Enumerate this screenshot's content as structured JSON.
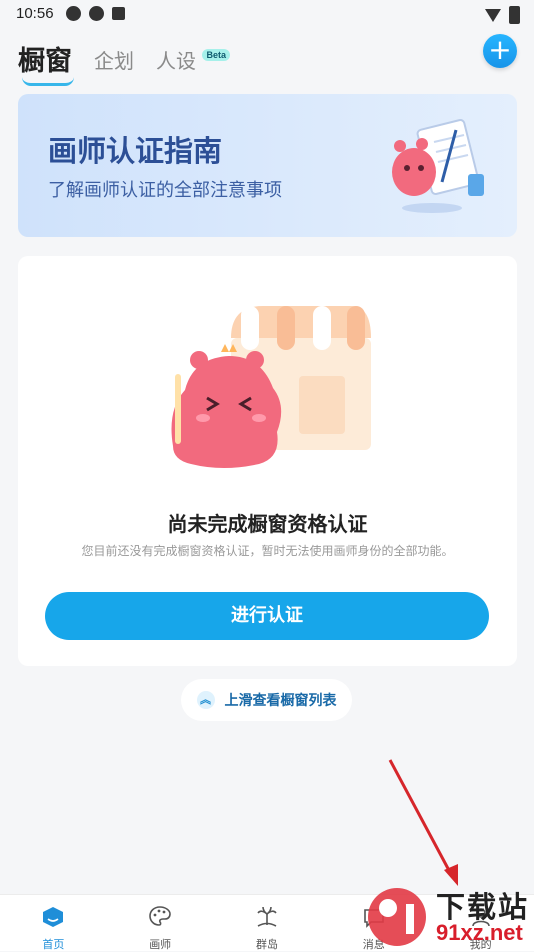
{
  "status_bar": {
    "time": "10:56"
  },
  "header": {
    "tabs": [
      {
        "label": "橱窗"
      },
      {
        "label": "企划"
      },
      {
        "label": "人设",
        "badge": "Beta"
      }
    ],
    "add_button": "+"
  },
  "banner": {
    "title": "画师认证指南",
    "subtitle": "了解画师认证的全部注意事项"
  },
  "card": {
    "title": "尚未完成橱窗资格认证",
    "description": "您目前还没有完成橱窗资格认证，暂时无法使用画师身份的全部功能。",
    "button": "进行认证"
  },
  "swipe_hint": {
    "label": "上滑查看橱窗列表",
    "icon": "double-chevron-up-icon"
  },
  "bottom_nav": [
    {
      "label": "首页",
      "icon": "home-icon"
    },
    {
      "label": "画师",
      "icon": "palette-icon"
    },
    {
      "label": "群岛",
      "icon": "island-icon"
    },
    {
      "label": "消息",
      "icon": "message-icon"
    },
    {
      "label": "我的",
      "icon": "profile-icon"
    }
  ],
  "watermark": {
    "line1": "下载站",
    "line2": "91xz.net"
  },
  "colors": {
    "accent": "#17a6ea",
    "banner_text": "#2c4f96",
    "mascot": "#f26a7e"
  }
}
